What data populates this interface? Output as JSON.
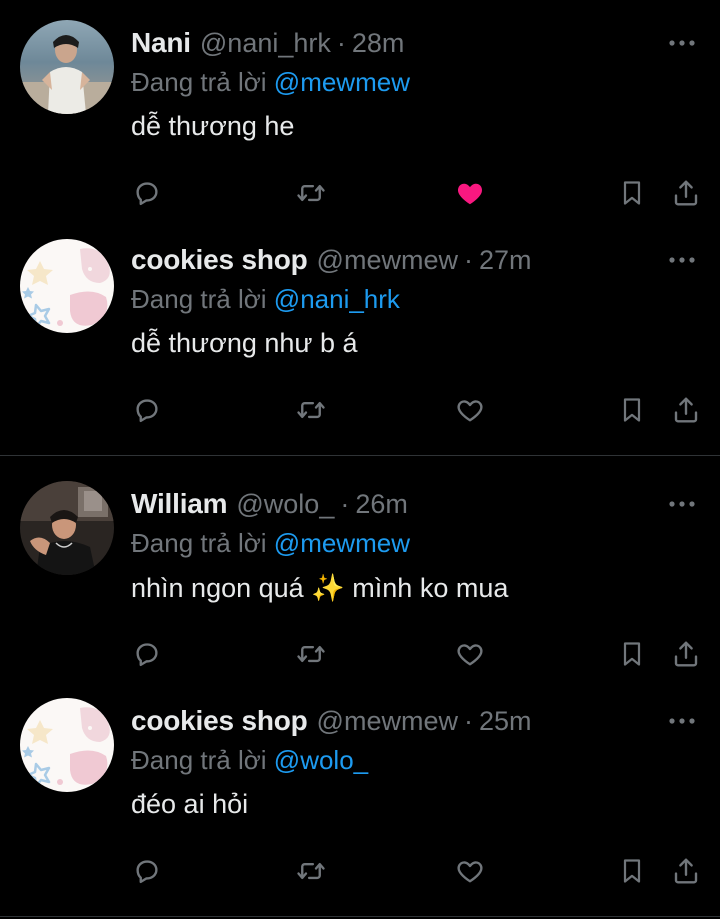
{
  "replying_prefix": "Đang trả lời",
  "colors": {
    "background": "#000000",
    "text": "#e7e9ea",
    "secondary": "#71767b",
    "link": "#1d9bf0",
    "like_active": "#f91880"
  },
  "tweets": [
    {
      "name": "Nani",
      "handle": "@nani_hrk",
      "dot": "·",
      "time": "28m",
      "replying_to": "@mewmew",
      "content": "dễ thương he",
      "liked": true,
      "avatar": "photo-man-beach"
    },
    {
      "name": "cookies shop",
      "handle": "@mewmew",
      "dot": "·",
      "time": "27m",
      "replying_to": "@nani_hrk",
      "content": "dễ thương như b á",
      "liked": false,
      "avatar": "pastel-stars-illustration"
    },
    {
      "name": "William",
      "handle": "@wolo_",
      "dot": "·",
      "time": "26m",
      "replying_to": "@mewmew",
      "content": "nhìn ngon quá ✨ mình ko mua",
      "liked": false,
      "avatar": "photo-man-dark-room"
    },
    {
      "name": "cookies shop",
      "handle": "@mewmew",
      "dot": "·",
      "time": "25m",
      "replying_to": "@wolo_",
      "content": "đéo ai hỏi",
      "liked": false,
      "avatar": "pastel-stars-illustration"
    }
  ]
}
